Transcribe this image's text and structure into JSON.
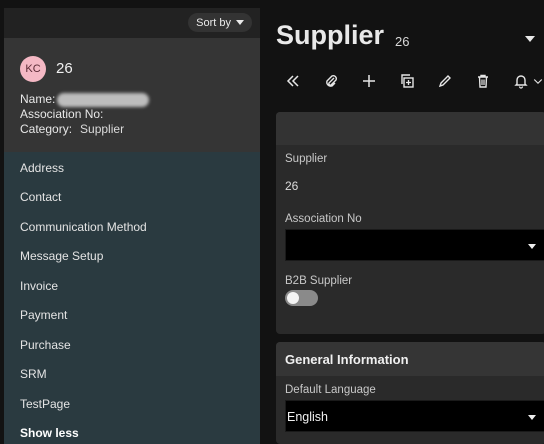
{
  "sidebar": {
    "sort_label": "Sort by",
    "card": {
      "avatar_initials": "KC",
      "id": "26",
      "name_label": "Name:",
      "assoc_label": "Association No:",
      "category_label": "Category:",
      "category_value": "Supplier"
    },
    "items": [
      {
        "label": "Address"
      },
      {
        "label": "Contact"
      },
      {
        "label": "Communication Method"
      },
      {
        "label": "Message Setup"
      },
      {
        "label": "Invoice"
      },
      {
        "label": "Payment"
      },
      {
        "label": "Purchase"
      },
      {
        "label": "SRM"
      },
      {
        "label": "TestPage"
      }
    ],
    "show_less": "Show less"
  },
  "header": {
    "title": "Supplier",
    "record_id": "26"
  },
  "toolbar": {
    "icons": [
      "double-chevron-left-icon",
      "paperclip-icon",
      "plus-icon",
      "duplicate-icon",
      "pencil-icon",
      "trash-icon",
      "bell-icon"
    ]
  },
  "form": {
    "supplier_label": "Supplier",
    "supplier_value": "26",
    "association_label": "Association No",
    "association_value": "",
    "b2b_label": "B2B Supplier",
    "b2b_enabled": false
  },
  "general": {
    "title": "General Information",
    "language_label": "Default Language",
    "language_value": "English"
  },
  "colors": {
    "sidebar_bg": "#2a3a40",
    "card_bg": "#353535",
    "avatar_bg": "#f4b8c4",
    "page_bg": "#121212"
  }
}
